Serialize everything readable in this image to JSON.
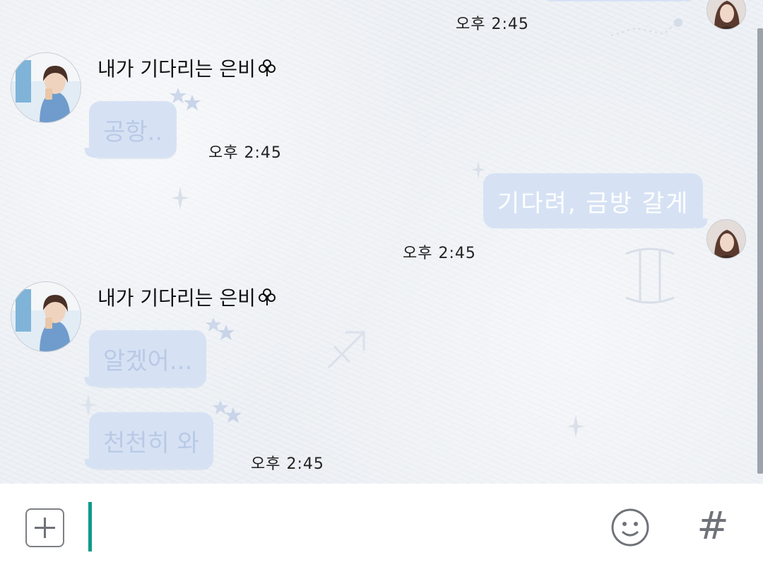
{
  "conversation": {
    "messages": [
      {
        "id": "m1",
        "direction": "out",
        "bubbles": [],
        "time": "오후 2:45"
      },
      {
        "id": "m2",
        "direction": "in",
        "sender": "내가 기다리는 은비",
        "sender_suffix_icon": "club-icon",
        "bubbles": [
          "공항.."
        ],
        "time": "오후 2:45"
      },
      {
        "id": "m3",
        "direction": "out",
        "bubbles": [
          "기다려, 금방 갈게"
        ],
        "time": "오후 2:45"
      },
      {
        "id": "m4",
        "direction": "in",
        "sender": "내가 기다리는 은비",
        "sender_suffix_icon": "club-icon",
        "bubbles": [
          "알겠어...",
          "천천히 와"
        ],
        "time": "오후 2:45"
      }
    ]
  },
  "input_bar": {
    "value": "",
    "placeholder": "",
    "icons": {
      "attach": "plus-square-icon",
      "emoji": "smiley-icon",
      "hashtag": "#"
    }
  },
  "colors": {
    "incoming_bubble": "#d6e2f4",
    "incoming_text": "#b9c9e6",
    "outgoing_bubble": "#d6e2f4",
    "outgoing_text": "#ffffff",
    "cursor": "#0e9a8a",
    "chat_background": "#eef1f5"
  }
}
